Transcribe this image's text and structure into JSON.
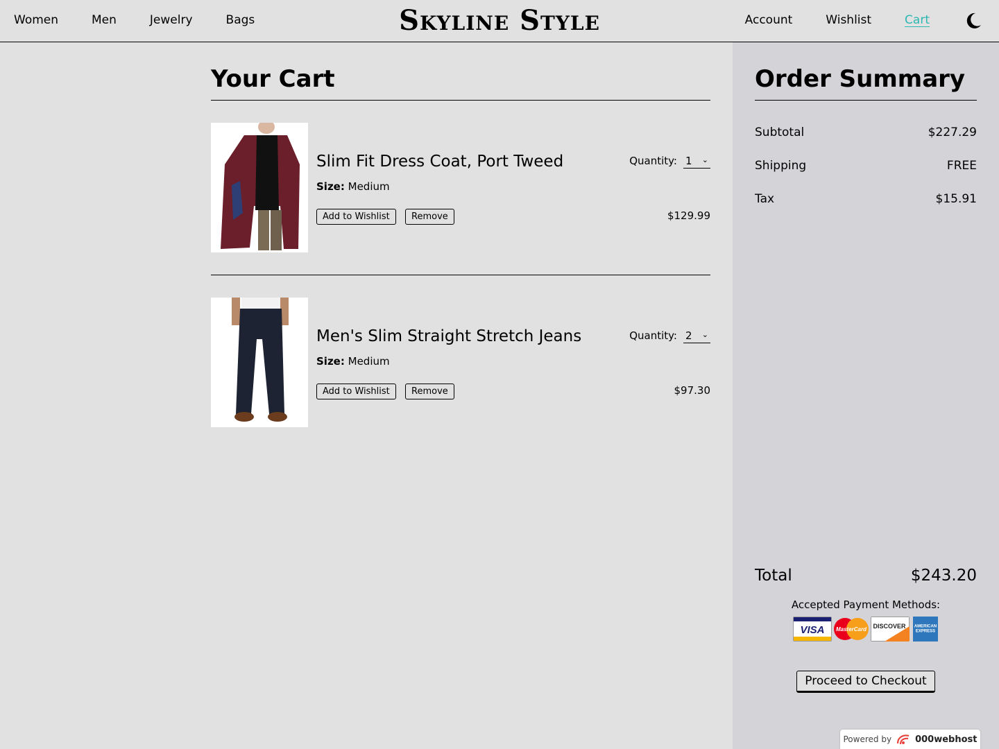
{
  "nav": {
    "left": [
      "Women",
      "Men",
      "Jewelry",
      "Bags"
    ],
    "brand": "Skyline Style",
    "right": [
      "Account",
      "Wishlist",
      "Cart"
    ],
    "active": "Cart",
    "active_color": "#2bb7b2",
    "theme_toggle_icon": "moon-icon"
  },
  "cart": {
    "title": "Your Cart",
    "quantity_label": "Quantity:",
    "size_label": "Size:",
    "wishlist_label": "Add to Wishlist",
    "remove_label": "Remove",
    "items": [
      {
        "name": "Slim Fit Dress Coat, Port Tweed",
        "size": "Medium",
        "quantity": "1",
        "price": "$129.99",
        "image": "burgundy-coat-photo"
      },
      {
        "name": "Men's Slim Straight Stretch Jeans",
        "size": "Medium",
        "quantity": "2",
        "price": "$97.30",
        "image": "dark-jeans-photo"
      }
    ]
  },
  "summary": {
    "title": "Order Summary",
    "subtotal_label": "Subtotal",
    "subtotal": "$227.29",
    "shipping_label": "Shipping",
    "shipping": "FREE",
    "tax_label": "Tax",
    "tax": "$15.91",
    "total_label": "Total",
    "total": "$243.20",
    "payment_label": "Accepted Payment Methods:",
    "payment_methods": [
      "VISA",
      "MasterCard",
      "DISCOVER",
      "AMERICAN EXPRESS"
    ],
    "checkout_label": "Proceed to Checkout"
  },
  "footer": {
    "powered_by": "Powered by",
    "host": "000webhost"
  }
}
